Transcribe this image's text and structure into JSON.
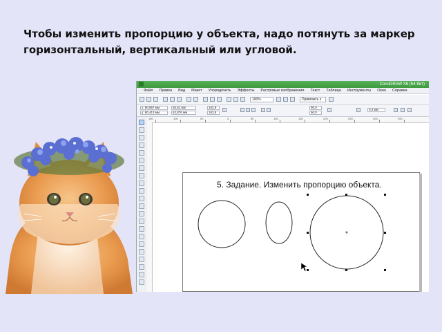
{
  "slide": {
    "instruction_line1": "Чтобы изменить пропорцию у объекта, надо потянуть за маркер",
    "instruction_line2": "горизонтальный, вертикальный или угловой."
  },
  "app": {
    "window_title": "CorelDRAW X6 (64-бит)",
    "menu": [
      "Файл",
      "Правка",
      "Вид",
      "Макет",
      "Упорядочить",
      "Эффекты",
      "Растровые изображения",
      "Текст",
      "Таблица",
      "Инструменты",
      "Окно",
      "Справка"
    ],
    "toolbar": {
      "zoom_value": "100%",
      "snap_label": "Привязать к"
    },
    "property_bar": {
      "x": "x: 90,957 мм",
      "y": "y: 90,413 мм",
      "width": "65,61 мм",
      "height": "62,876 мм",
      "scale_x": "162,9",
      "scale_y": "162,9",
      "angle1": "90,0",
      "angle2": "90,0",
      "outline_width": "0,2 мм"
    },
    "ruler_labels": [
      "150",
      "100",
      "50",
      "0",
      "50",
      "100",
      "150",
      "200",
      "250",
      "300",
      "350"
    ]
  },
  "canvas": {
    "task_title": "5. Задание. Изменить пропорцию объекта."
  },
  "icons": {
    "cursor": "mouse-pointer-icon",
    "app_logo": "coreldraw-logo-icon"
  }
}
